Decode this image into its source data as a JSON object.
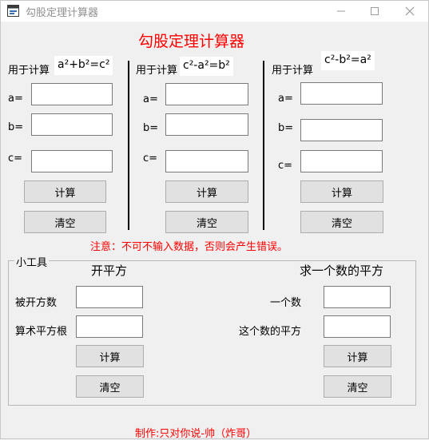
{
  "window": {
    "title": "勾股定理计算器",
    "controls": [
      "minimize",
      "maximize",
      "close"
    ]
  },
  "heading": "勾股定理计算器",
  "panels": [
    {
      "prefix": "用于计算",
      "formula": "a²+b²=c²",
      "labels": {
        "a": "a=",
        "b": "b=",
        "c": "c="
      },
      "values": {
        "a": "",
        "b": "",
        "c": ""
      },
      "calc_label": "计算",
      "clear_label": "清空"
    },
    {
      "prefix": "用于计算",
      "formula": "c²-a²=b²",
      "labels": {
        "a": "a=",
        "b": "b=",
        "c": "c="
      },
      "values": {
        "a": "",
        "b": "",
        "c": ""
      },
      "calc_label": "计算",
      "clear_label": "清空"
    },
    {
      "prefix": "用于计算",
      "formula": "c²-b²=a²",
      "labels": {
        "a": "a=",
        "b": "b=",
        "c": "c="
      },
      "values": {
        "a": "",
        "b": "",
        "c": ""
      },
      "calc_label": "计算",
      "clear_label": "清空"
    }
  ],
  "warning": "注意：不可不输入数据，否则会产生错误。",
  "tools": {
    "legend": "小工具",
    "sqrt": {
      "title": "开平方",
      "radicand_label": "被开方数",
      "root_label": "算术平方根",
      "radicand_value": "",
      "root_value": "",
      "calc_label": "计算",
      "clear_label": "清空"
    },
    "square": {
      "title": "求一个数的平方",
      "number_label": "一个数",
      "square_label": "这个数的平方",
      "number_value": "",
      "square_value": "",
      "calc_label": "计算",
      "clear_label": "清空"
    }
  },
  "footer": "制作:只对你说-帅（炸哥）",
  "colors": {
    "accent_text": "#ff0000",
    "window_bg": "#f0f0f0",
    "button_bg": "#e1e1e1"
  },
  "icons": {
    "app": "app-window-icon",
    "minimize": "minimize-icon",
    "maximize": "maximize-icon",
    "close": "close-icon"
  }
}
